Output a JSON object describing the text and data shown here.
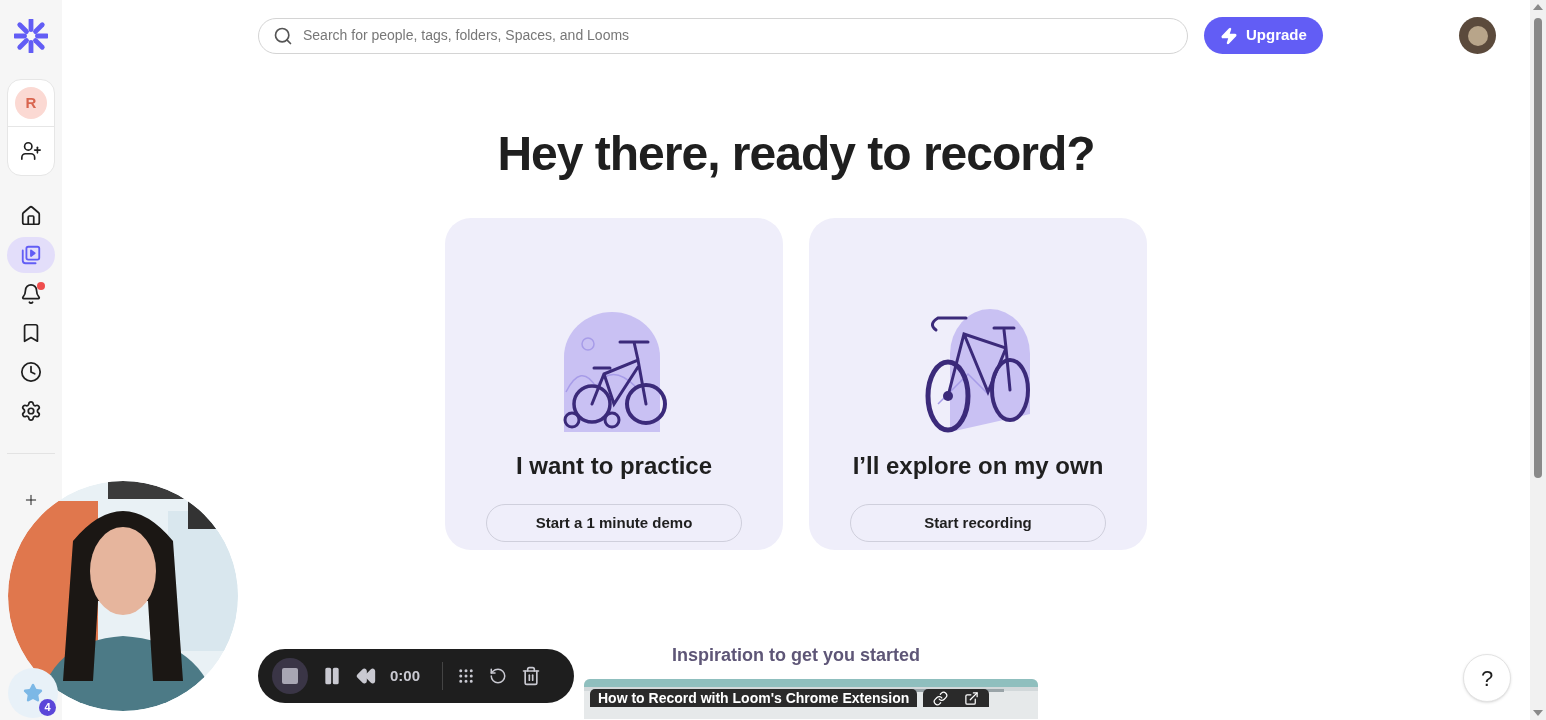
{
  "sidebar": {
    "workspace_initial": "R",
    "nav": [
      {
        "selected": false,
        "alert": false
      },
      {
        "selected": true,
        "alert": false
      },
      {
        "selected": false,
        "alert": true
      },
      {
        "selected": false,
        "alert": false
      },
      {
        "selected": false,
        "alert": false
      },
      {
        "selected": false,
        "alert": false
      }
    ],
    "tool_badge": "4"
  },
  "search": {
    "placeholder": "Search for people, tags, folders, Spaces, and Looms"
  },
  "upgrade_button": "Upgrade",
  "heading": "Hey there, ready to record?",
  "cards": [
    {
      "kind": "practice",
      "title": "I want to practice",
      "button": "Start a 1 minute demo"
    },
    {
      "kind": "explore",
      "title": "I’ll explore on my own",
      "button": "Start recording"
    }
  ],
  "inspiration": {
    "title": "Inspiration to get you started",
    "video_title": "How to Record with Loom's Chrome Extension"
  },
  "recorder": {
    "time": "0:00"
  },
  "help_button": "?"
}
